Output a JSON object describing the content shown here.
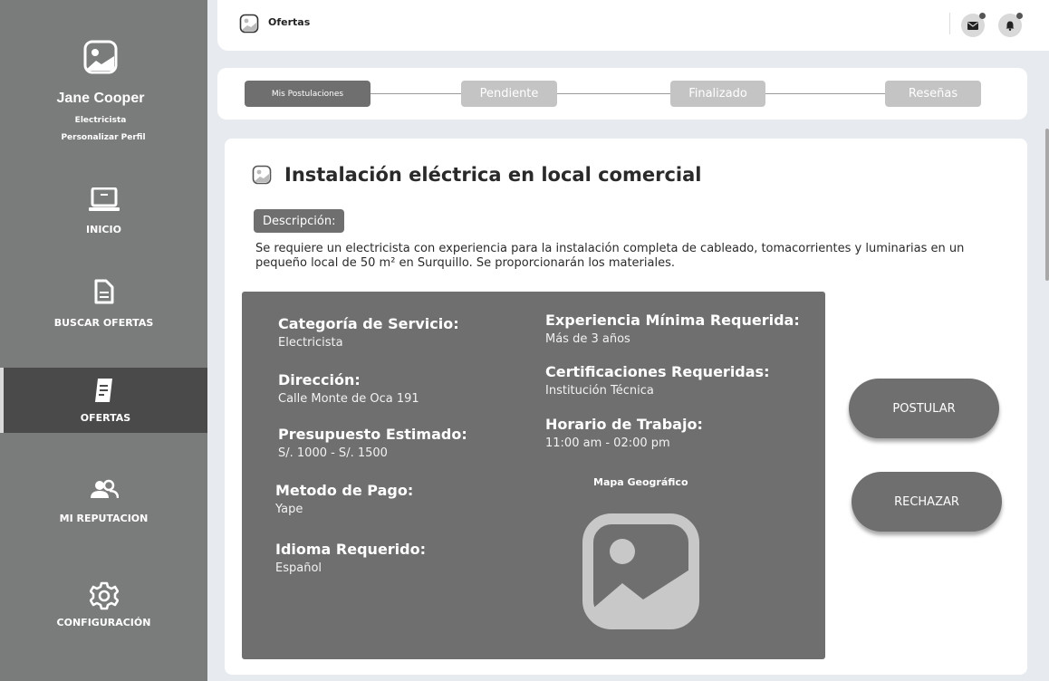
{
  "profile": {
    "name": "Jane Cooper",
    "role": "Electricista",
    "customize_link": "Personalizar Perfil"
  },
  "sidebar": {
    "items": [
      {
        "label": "INICIO",
        "icon": "laptop-icon"
      },
      {
        "label": "BUSCAR OFERTAS",
        "icon": "document-icon"
      },
      {
        "label": "OFERTAS",
        "icon": "offers-document-icon",
        "active": true
      },
      {
        "label": "MI REPUTACION",
        "icon": "users-icon"
      },
      {
        "label": "CONFIGURACIÓN",
        "icon": "gear-icon"
      }
    ]
  },
  "header": {
    "title": "Ofertas",
    "icons": [
      "mail-icon",
      "bell-icon"
    ]
  },
  "tabs": [
    {
      "label": "Mis Postulaciones",
      "active": true
    },
    {
      "label": "Pendiente"
    },
    {
      "label": "Finalizado"
    },
    {
      "label": "Reseñas"
    }
  ],
  "job": {
    "title": "Instalación eléctrica en local comercial",
    "description_label": "Descripción:",
    "description": "Se requiere un electricista con experiencia para la instalación completa de cableado, tomacorrientes y luminarias en un pequeño local de 50 m² en Surquillo. Se proporcionarán los materiales.",
    "fields": {
      "category": {
        "label": "Categoría de Servicio:",
        "value": "Electricista"
      },
      "address": {
        "label": "Dirección:",
        "value": "Calle Monte de Oca 191"
      },
      "budget": {
        "label": "Presupuesto Estimado:",
        "value": "S/. 1000 - S/. 1500"
      },
      "payment": {
        "label": "Metodo de Pago:",
        "value": "Yape"
      },
      "language": {
        "label": "Idioma Requerido:",
        "value": "Español"
      },
      "experience": {
        "label": "Experiencia Mínima Requerida:",
        "value": "Más de 3 años"
      },
      "certifications": {
        "label": "Certificaciones Requeridas:",
        "value": "Institución Técnica"
      },
      "schedule": {
        "label": "Horario de Trabajo:",
        "value": "11:00 am - 02:00 pm"
      }
    },
    "map_label": "Mapa Geográfico"
  },
  "actions": {
    "apply": "POSTULAR",
    "reject": "RECHAZAR"
  },
  "colors": {
    "sidebar": "#7a7b7b",
    "sidebar_active": "#4a4a4a",
    "panel": "#6f6f6f",
    "inactive_tab": "#c4c4c4",
    "background": "#e7eaee"
  }
}
